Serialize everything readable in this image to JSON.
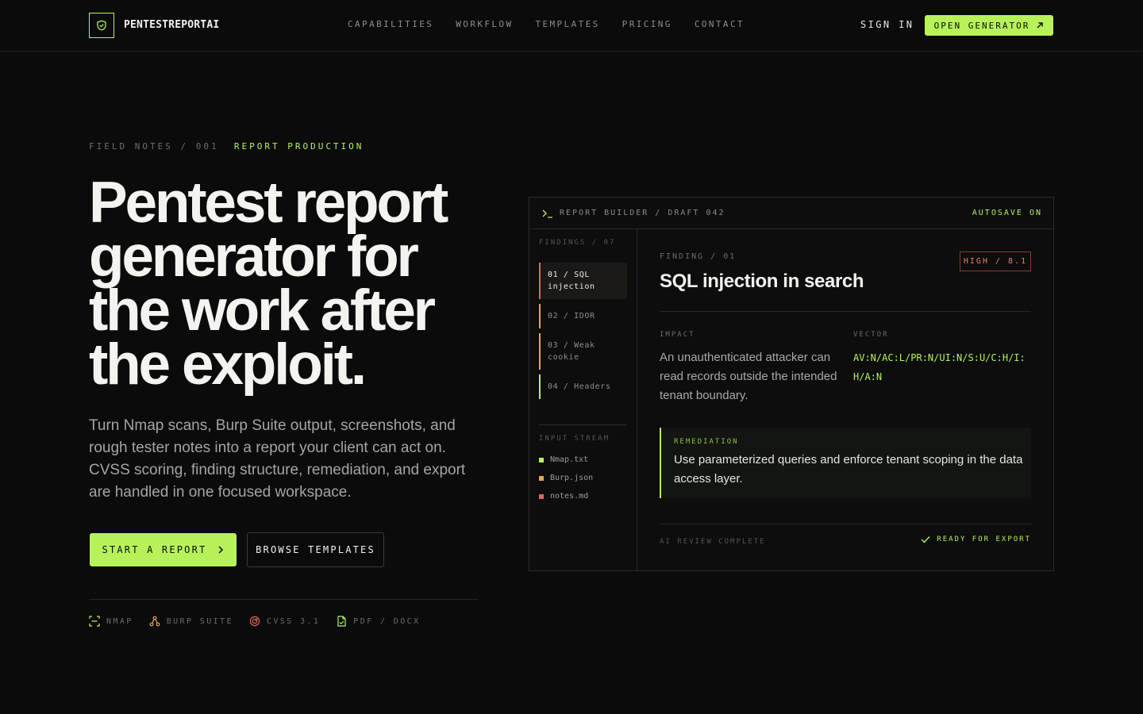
{
  "nav": {
    "brand": "PENTESTREPORTAI",
    "links": [
      "CAPABILITIES",
      "WORKFLOW",
      "TEMPLATES",
      "PRICING",
      "CONTACT"
    ],
    "sign_in": "SIGN IN",
    "open_generator": "OPEN GENERATOR"
  },
  "hero": {
    "eyebrow_dim": "FIELD NOTES / 001",
    "eyebrow_accent": "REPORT PRODUCTION",
    "title": "Pentest report generator for the work after the exploit.",
    "subtitle": "Turn Nmap scans, Burp Suite output, screenshots, and rough tester notes into a report your client can act on. CVSS scoring, finding structure, remediation, and export are handled in one focused workspace.",
    "start_button": "START A REPORT",
    "browse_button": "BROWSE TEMPLATES",
    "integrations": [
      "NMAP",
      "BURP SUITE",
      "CVSS 3.1",
      "PDF / DOCX"
    ]
  },
  "builder": {
    "header_title": "REPORT BUILDER / DRAFT 042",
    "autosave": "AUTOSAVE ON",
    "findings_label": "FINDINGS / 07",
    "findings": [
      {
        "label": "01 / SQL injection",
        "color": "#e0655a"
      },
      {
        "label": "02 / IDOR",
        "color": "#e7a84f"
      },
      {
        "label": "03 / Weak cookie",
        "color": "#e7a84f"
      },
      {
        "label": "04 / Headers",
        "color": "#b7f25a"
      }
    ],
    "input_stream_label": "INPUT STREAM",
    "inputs": [
      {
        "name": "Nmap.txt",
        "color": "#b7f25a"
      },
      {
        "name": "Burp.json",
        "color": "#e7a84f"
      },
      {
        "name": "notes.md",
        "color": "#e0655a"
      }
    ],
    "finding_label": "FINDING / 01",
    "severity": "HIGH / 8.1",
    "finding_title": "SQL injection in search",
    "impact_label": "IMPACT",
    "impact_text": "An unauthenticated attacker can read records outside the intended tenant boundary.",
    "vector_label": "VECTOR",
    "vector": "AV:N/AC:L/PR:N/UI:N/S:U/C:H/I:H/A:N",
    "remediation_label": "REMEDIATION",
    "remediation_text": "Use parameterized queries and enforce tenant scoping in the data access layer.",
    "ai_review": "AI REVIEW COMPLETE",
    "ready": "READY FOR EXPORT"
  },
  "colors": {
    "accent": "#b7f25a",
    "background": "#0a0b0a",
    "danger": "#e0655a",
    "warning": "#e7a84f"
  }
}
